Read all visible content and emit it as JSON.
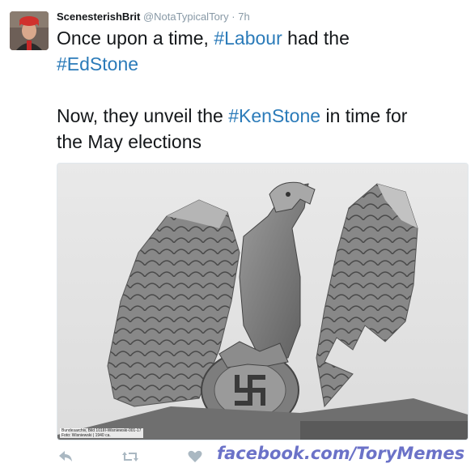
{
  "tweet": {
    "author_name": "ScenesterishBrit",
    "handle": "@NotaTypicalTory",
    "separator": "·",
    "time": "7h",
    "line1_before": "Once upon a time, ",
    "line1_hashtag": "#Labour",
    "line1_after": " had the",
    "line2_hashtag": "#EdStone",
    "line3_before": "Now, they unveil the ",
    "line3_hashtag": "#KenStone",
    "line3_after": " in time for",
    "line4": "the May elections"
  },
  "photo": {
    "caption_line1": "Bundesarchiv, Bild 101III-Wisniewski-001-17",
    "caption_line2": "Foto: Wisniewski | 1940 ca.",
    "description_icon": "stone-eagle-sculpture"
  },
  "actions": [
    {
      "name": "reply-icon"
    },
    {
      "name": "retweet-icon"
    },
    {
      "name": "like-icon"
    }
  ],
  "watermark": "facebook.com/ToryMemes",
  "colors": {
    "hashtag": "#2b7bb9",
    "muted": "#8899a6",
    "watermark": "#6b72c8"
  }
}
